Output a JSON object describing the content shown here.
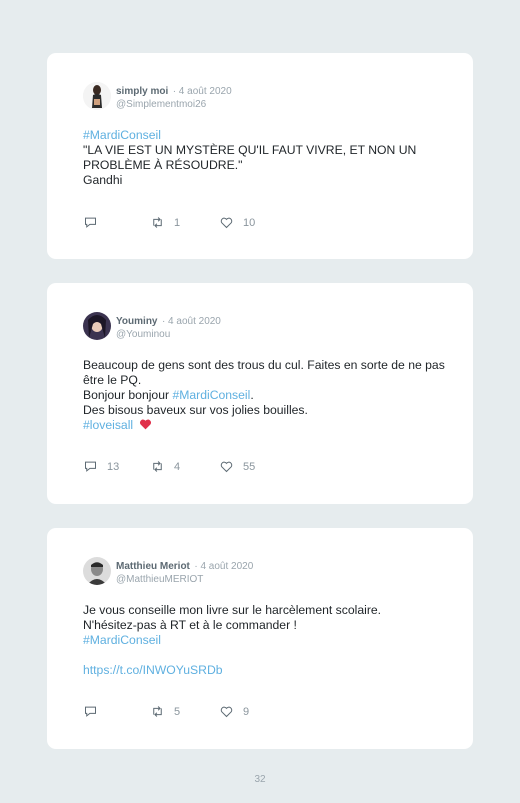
{
  "tweets": [
    {
      "name": "simply moi",
      "date": "· 4 août 2020",
      "handle": "@Simplementmoi26",
      "lines": {
        "l1": "#MardiConseil",
        "l2": "\"LA VIE EST UN MYSTÈRE QU'IL FAUT VIVRE, ET NON UN PROBLÈME À RÉSOUDRE.\"",
        "l3": "Gandhi"
      },
      "replies": "",
      "retweets": "1",
      "likes": "10"
    },
    {
      "name": "Youminy",
      "date": "· 4 août 2020",
      "handle": "@Youminou",
      "lines": {
        "l1": "Beaucoup de gens sont des trous du cul. Faites en sorte de ne pas être le PQ.",
        "l2a": "Bonjour bonjour ",
        "l2b": "#MardiConseil",
        "l2c": ".",
        "l3": "Des bisous baveux sur vos jolies bouilles.",
        "l4": "#loveisall"
      },
      "replies": "13",
      "retweets": "4",
      "likes": "55"
    },
    {
      "name": "Matthieu Meriot",
      "date": "· 4 août 2020",
      "handle": "@MatthieuMERIOT",
      "lines": {
        "l1": "Je vous conseille mon livre sur le harcèlement scolaire.",
        "l2": "N'hésitez-pas à RT et à le commander !",
        "l3": "#MardiConseil",
        "l4": "https://t.co/INWOYuSRDb"
      },
      "replies": "",
      "retweets": "5",
      "likes": "9"
    }
  ],
  "page_number": "32",
  "colors": {
    "background": "#e6ecee",
    "card": "#ffffff",
    "hashtag": "#5fb0e0",
    "heart": "#e0304a"
  },
  "icons": [
    "reply-icon",
    "retweet-icon",
    "like-icon",
    "red-heart-emoji"
  ]
}
